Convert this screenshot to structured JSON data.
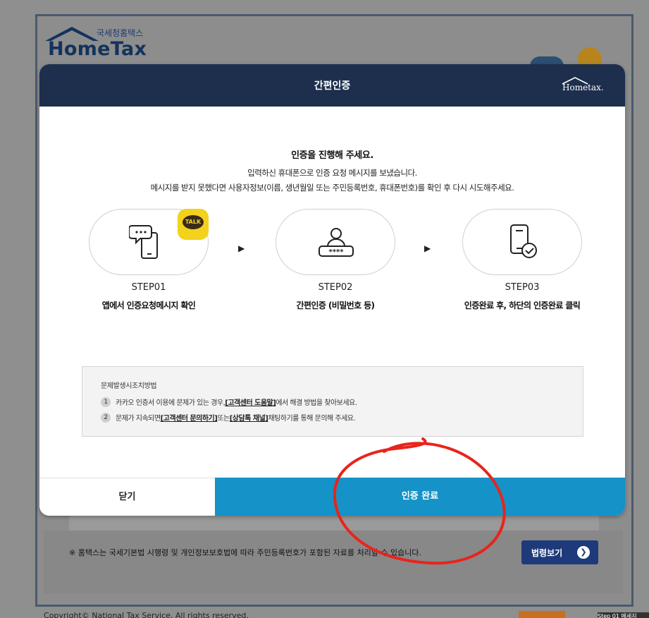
{
  "background": {
    "logo_small": "국세청홈택스",
    "logo_big": "HomeTax",
    "notice": "※ 홈택스는 국세기본법 시행령 및 개인정보보호법에 따라 주민등록번호가 포함된 자료를 처리할 수 있습니다.",
    "law_button": "법령보기",
    "copyright": "Copyright© National Tax Service. All rights reserved.",
    "badge_text": "Step 01 메세지"
  },
  "modal": {
    "title": "간편인증",
    "logo_text": "Hometax.",
    "headline": "인증을 진행해 주세요.",
    "desc_line1": "입력하신 휴대폰으로 인증 요청 메시지를 보냈습니다.",
    "desc_line2": "메시지를 받지 못했다면 사용자정보(이름, 생년월일 또는 주민등록번호, 휴대폰번호)를 확인 후 다시 시도해주세요.",
    "steps": [
      {
        "label": "STEP01",
        "desc": "앱에서 인증요청메시지 확인",
        "icon": "chat-phone-icon"
      },
      {
        "label": "STEP02",
        "desc": "간편인증 (비밀번호 등)",
        "icon": "user-password-icon"
      },
      {
        "label": "STEP03",
        "desc": "인증완료 후, 하단의 인증완료 클릭",
        "icon": "phone-check-icon"
      }
    ],
    "talk_badge": "TALK",
    "arrow": "▶",
    "trouble": {
      "title": "문제발생시조치방법",
      "item1_num": "1",
      "item1_pre": "카카오 인증서 이용에 문제가 있는 경우, ",
      "item1_link": "[고객센터 도움말]",
      "item1_post": " 에서 해결 방법을 찾아보세요.",
      "item2_num": "2",
      "item2_pre": "문제가 지속되면 ",
      "item2_link1": "[고객센터 문의하기]",
      "item2_mid": " 또는 ",
      "item2_link2": "[상담톡 채널]",
      "item2_post": " 채팅하기를 통해 문의해 주세요."
    },
    "close_button": "닫기",
    "done_button": "인증 완료"
  },
  "colors": {
    "header_bg": "#1d2f4d",
    "done_button_bg": "#1592c7",
    "annotation": "#e8241c"
  }
}
